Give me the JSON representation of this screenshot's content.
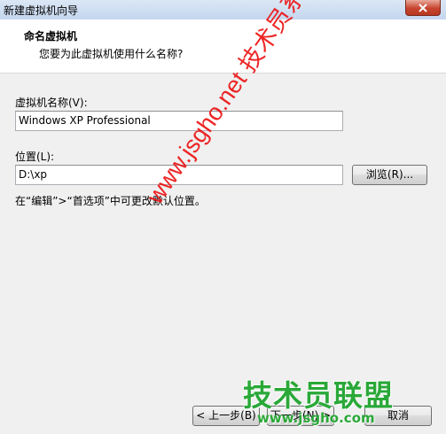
{
  "window": {
    "title": "新建虚拟机向导"
  },
  "header": {
    "title": "命名虚拟机",
    "subtitle": "您要为此虚拟机使用什么名称?"
  },
  "name_field": {
    "label": "虚拟机名称(V):",
    "value": "Windows XP Professional"
  },
  "location_field": {
    "label": "位置(L):",
    "value": "D:\\xp",
    "browse_label": "浏览(R)..."
  },
  "hint": "在“编辑”>“首选项”中可更改默认位置。",
  "buttons": {
    "back_label": "< 上一步(B)",
    "next_label": "下一步(N) >",
    "cancel_label": "取消"
  },
  "watermarks": {
    "diagonal": "www.jsgho.net 技术员系统",
    "logo": "技术员联盟",
    "url": "www.jsgho.com"
  },
  "icons": {
    "close": "close-icon"
  },
  "colors": {
    "watermark_red": "#eb1414",
    "watermark_green": "#2aa838",
    "close_red": "#c7452f"
  }
}
